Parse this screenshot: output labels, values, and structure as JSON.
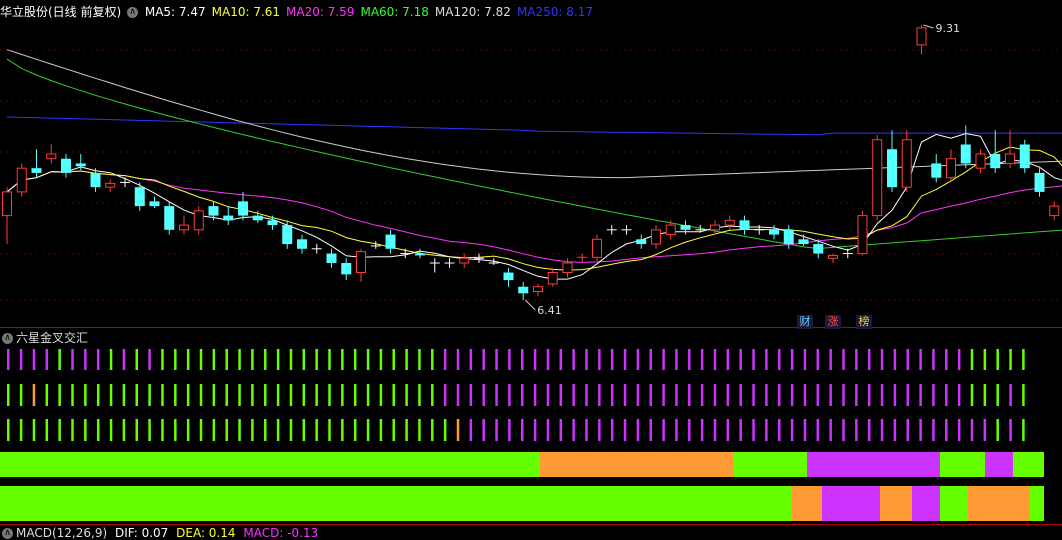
{
  "header": {
    "title": "华立股份(日线 前复权)",
    "ma": [
      {
        "label": "MA5: 7.47",
        "color": "#ffffff"
      },
      {
        "label": "MA10: 7.61",
        "color": "#ffff33"
      },
      {
        "label": "MA20: 7.59",
        "color": "#ff33ff"
      },
      {
        "label": "MA60: 7.18",
        "color": "#33ff33"
      },
      {
        "label": "MA120: 7.82",
        "color": "#dddddd"
      },
      {
        "label": "MA250: 8.17",
        "color": "#3333ff"
      }
    ]
  },
  "price": {
    "high_label": "9.31",
    "low_label": "6.41",
    "high": 9.31,
    "low": 6.41
  },
  "badges": [
    "财",
    "涨",
    "榜"
  ],
  "indicator": {
    "title": "六星金叉交汇"
  },
  "macd": {
    "label": "MACD(12,26,9)",
    "dif": "DIF: 0.07",
    "dea": "DEA: 0.14",
    "macd": "MACD: -0.13"
  },
  "colors": {
    "up": "#ff3b3b",
    "down": "#54ffff",
    "grid": "#5a0000",
    "green": "#66ff00",
    "orange": "#ff9933",
    "purple": "#cc33ff"
  },
  "candles": [
    [
      7.3,
      7.55,
      7.0,
      7.6
    ],
    [
      7.55,
      7.8,
      7.5,
      7.85
    ],
    [
      7.8,
      7.75,
      7.7,
      8.0
    ],
    [
      7.9,
      7.95,
      7.85,
      8.05
    ],
    [
      7.9,
      7.75,
      7.7,
      7.95
    ],
    [
      7.85,
      7.82,
      7.78,
      7.95
    ],
    [
      7.75,
      7.6,
      7.55,
      7.8
    ],
    [
      7.6,
      7.64,
      7.55,
      7.68
    ],
    [
      7.65,
      7.64,
      7.6,
      7.7
    ],
    [
      7.6,
      7.4,
      7.35,
      7.65
    ],
    [
      7.45,
      7.4,
      7.38,
      7.5
    ],
    [
      7.4,
      7.15,
      7.1,
      7.45
    ],
    [
      7.15,
      7.2,
      7.1,
      7.3
    ],
    [
      7.15,
      7.35,
      7.1,
      7.4
    ],
    [
      7.4,
      7.3,
      7.25,
      7.45
    ],
    [
      7.3,
      7.25,
      7.2,
      7.4
    ],
    [
      7.45,
      7.3,
      7.25,
      7.55
    ],
    [
      7.3,
      7.25,
      7.22,
      7.35
    ],
    [
      7.25,
      7.2,
      7.15,
      7.3
    ],
    [
      7.2,
      7.0,
      6.95,
      7.25
    ],
    [
      7.05,
      6.95,
      6.9,
      7.1
    ],
    [
      6.95,
      6.95,
      6.9,
      7.0
    ],
    [
      6.9,
      6.8,
      6.75,
      6.95
    ],
    [
      6.8,
      6.68,
      6.62,
      6.85
    ],
    [
      6.7,
      6.92,
      6.6,
      6.95
    ],
    [
      6.98,
      6.98,
      6.95,
      7.03
    ],
    [
      7.1,
      6.95,
      6.9,
      7.15
    ],
    [
      6.9,
      6.9,
      6.85,
      6.95
    ],
    [
      6.9,
      6.88,
      6.85,
      6.95
    ],
    [
      6.8,
      6.8,
      6.7,
      6.85
    ],
    [
      6.8,
      6.8,
      6.75,
      6.85
    ],
    [
      6.8,
      6.85,
      6.75,
      6.9
    ],
    [
      6.85,
      6.85,
      6.8,
      6.9
    ],
    [
      6.8,
      6.8,
      6.78,
      6.85
    ],
    [
      6.7,
      6.62,
      6.55,
      6.75
    ],
    [
      6.55,
      6.48,
      6.41,
      6.6
    ],
    [
      6.5,
      6.55,
      6.45,
      6.58
    ],
    [
      6.58,
      6.7,
      6.55,
      6.75
    ],
    [
      6.7,
      6.8,
      6.65,
      6.85
    ],
    [
      6.85,
      6.86,
      6.8,
      6.9
    ],
    [
      6.86,
      7.05,
      6.82,
      7.1
    ],
    [
      7.15,
      7.15,
      7.1,
      7.2
    ],
    [
      7.15,
      7.15,
      7.1,
      7.2
    ],
    [
      7.05,
      7.0,
      6.95,
      7.1
    ],
    [
      7.0,
      7.15,
      6.95,
      7.2
    ],
    [
      7.1,
      7.2,
      7.05,
      7.25
    ],
    [
      7.2,
      7.15,
      7.1,
      7.25
    ],
    [
      7.15,
      7.15,
      7.12,
      7.2
    ],
    [
      7.15,
      7.2,
      7.1,
      7.25
    ],
    [
      7.2,
      7.25,
      7.15,
      7.3
    ],
    [
      7.25,
      7.15,
      7.1,
      7.3
    ],
    [
      7.15,
      7.15,
      7.1,
      7.2
    ],
    [
      7.15,
      7.1,
      7.05,
      7.2
    ],
    [
      7.15,
      7.0,
      6.95,
      7.2
    ],
    [
      7.05,
      7.0,
      6.98,
      7.1
    ],
    [
      7.0,
      6.9,
      6.85,
      7.05
    ],
    [
      6.85,
      6.88,
      6.8,
      6.9
    ],
    [
      6.9,
      6.9,
      6.85,
      6.95
    ],
    [
      6.9,
      7.3,
      6.88,
      7.35
    ],
    [
      7.3,
      8.1,
      7.25,
      8.15
    ],
    [
      8.0,
      7.6,
      7.55,
      8.2
    ],
    [
      7.6,
      8.1,
      7.55,
      8.2
    ],
    [
      9.1,
      9.28,
      9.0,
      9.31
    ],
    [
      7.85,
      7.7,
      7.65,
      7.95
    ],
    [
      7.7,
      7.9,
      7.65,
      8.0
    ],
    [
      8.05,
      7.85,
      7.8,
      8.25
    ],
    [
      7.8,
      7.95,
      7.75,
      8.0
    ],
    [
      7.95,
      7.8,
      7.75,
      8.2
    ],
    [
      7.85,
      7.95,
      7.8,
      8.2
    ],
    [
      8.05,
      7.8,
      7.75,
      8.1
    ],
    [
      7.75,
      7.55,
      7.5,
      7.8
    ],
    [
      7.3,
      7.4,
      7.25,
      7.45
    ],
    [
      7.4,
      7.55,
      7.35,
      7.6
    ],
    [
      7.55,
      7.58,
      7.5,
      7.65
    ],
    [
      7.58,
      7.58,
      7.53,
      7.65
    ],
    [
      7.6,
      7.55,
      7.5,
      7.7
    ],
    [
      7.55,
      7.45,
      7.4,
      7.6
    ]
  ],
  "rows": {
    "r1": "ppppgpppgpgpggggggggggggggggggggggpppppppppppppppppppppppppppppppppppppppppggggg",
    "r2": "ggogggggggggggggggggggggggggggggggpppppppppppppppppppppppppppppppppppppppppgggpg",
    "r3": "gggggggggggggggggggggggggggggggggggopppppppppppppppppppppppppppppppppppppppppgpg"
  },
  "band1": [
    [
      0,
      540,
      "g"
    ],
    [
      540,
      733,
      "o"
    ],
    [
      733,
      807,
      "g"
    ],
    [
      807,
      940,
      "p"
    ],
    [
      940,
      985,
      "g"
    ],
    [
      985,
      1013,
      "p"
    ],
    [
      1013,
      1044,
      "g"
    ]
  ],
  "band2": [
    [
      0,
      792,
      "g"
    ],
    [
      792,
      822,
      "o"
    ],
    [
      822,
      880,
      "p"
    ],
    [
      880,
      912,
      "o"
    ],
    [
      912,
      940,
      "p"
    ],
    [
      940,
      968,
      "g"
    ],
    [
      968,
      1030,
      "o"
    ],
    [
      1030,
      1044,
      "g"
    ]
  ]
}
